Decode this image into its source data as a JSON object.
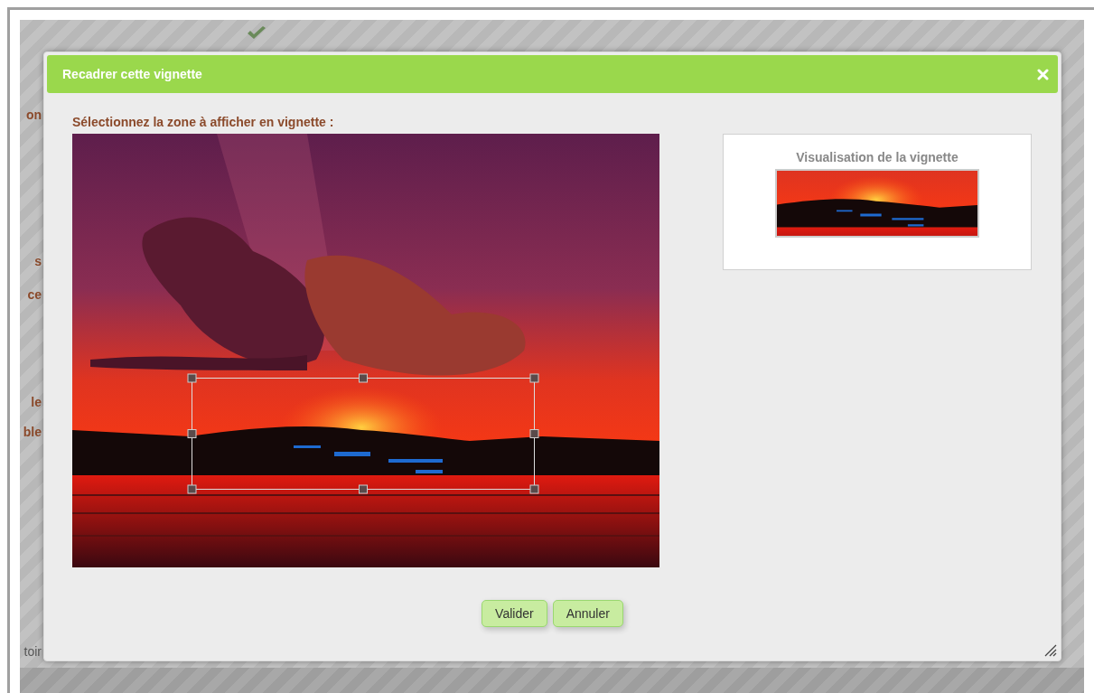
{
  "background": {
    "fragments": [
      {
        "text": "on",
        "kind": "label"
      },
      {
        "text": "s",
        "kind": "label"
      },
      {
        "text": "ce",
        "kind": "label"
      },
      {
        "text": "le",
        "kind": "label"
      },
      {
        "text": "ble",
        "kind": "label"
      },
      {
        "text": "toir",
        "kind": "value"
      }
    ]
  },
  "dialog": {
    "title": "Recadrer cette vignette",
    "instruction": "Sélectionnez la zone à afficher en vignette :",
    "preview": {
      "title": "Visualisation de la vignette"
    },
    "buttons": [
      "Valider",
      "Annuler"
    ]
  }
}
